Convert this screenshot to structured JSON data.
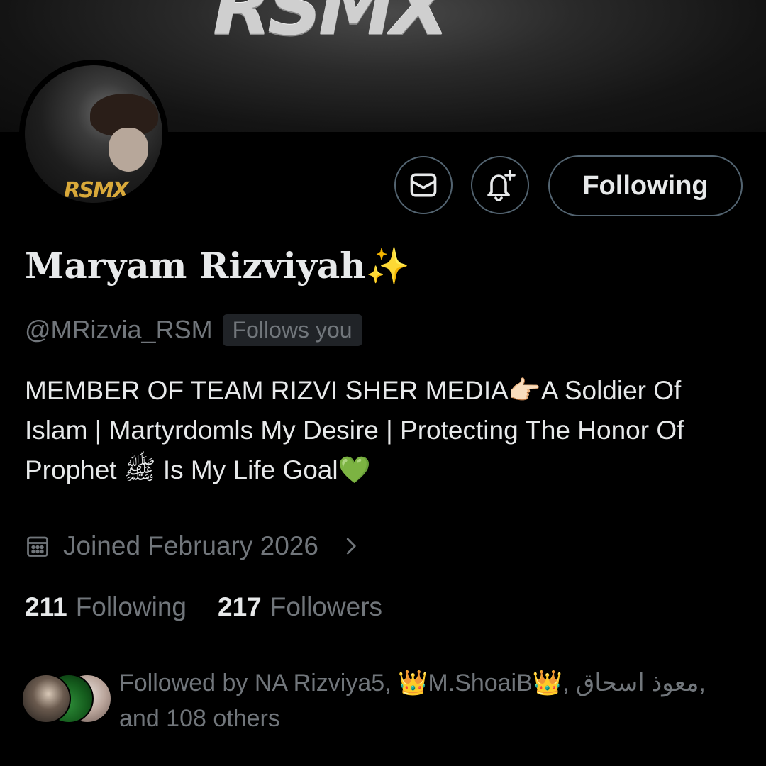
{
  "banner": {
    "logo_text": "RSMX"
  },
  "avatar": {
    "logo_text": "RSMX"
  },
  "actions": {
    "follow_button_label": "Following"
  },
  "profile": {
    "name": "Maryam Rizviyah✨",
    "handle": "@MRizvia_RSM",
    "follows_you_badge": "Follows you",
    "bio": "MEMBER OF TEAM RIZVI SHER MEDIA👉🏻A Soldier Of Islam | Martyrdomls My Desire | Protecting The Honor Of Prophet ﷺ Is My Life Goal💚",
    "joined": "Joined February 2026"
  },
  "stats": {
    "following_count": "211",
    "following_label": "Following",
    "followers_count": "217",
    "followers_label": "Followers"
  },
  "followed_by": {
    "text": "Followed by NA Rizviya5, 👑M.ShoaiB👑, معوذ اسحاق, and 108 others"
  },
  "colors": {
    "background": "#000000",
    "primary_text": "#e7e9ea",
    "secondary_text": "#71767b",
    "border": "#536471"
  }
}
